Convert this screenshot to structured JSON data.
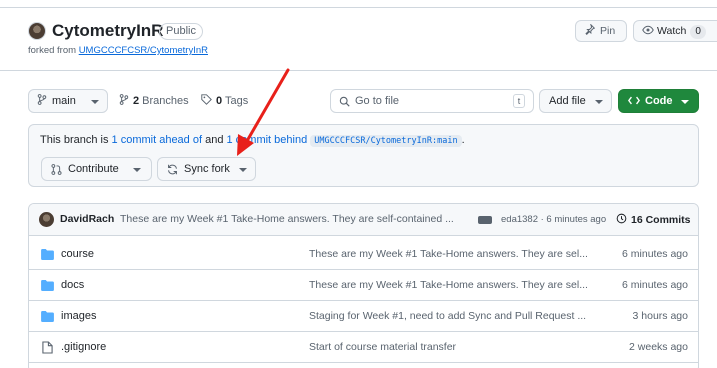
{
  "repo": {
    "name": "CytometryInR",
    "visibility": "Public",
    "forked_prefix": "forked from ",
    "forked_source": "UMGCCCFCSR/CytometryInR",
    "pin_label": "Pin",
    "watch_label": "Watch",
    "watch_count": "0"
  },
  "toolbar": {
    "branch": "main",
    "branches_count": "2",
    "branches_label": " Branches",
    "tags_count": "0",
    "tags_label": " Tags",
    "goto_placeholder": "Go to file",
    "goto_key": "t",
    "add_file_label": "Add file",
    "code_label": "Code"
  },
  "fork_status": {
    "prefix": "This branch is ",
    "ahead": "1 commit ahead of",
    "middle": " and ",
    "behind": "1 commit behind",
    "upstream": "UMGCCCFCSR/CytometryInR:main",
    "suffix": ".",
    "contribute_label": "Contribute",
    "sync_label": "Sync fork"
  },
  "latest_commit": {
    "author": "DavidRach",
    "message": "These are my Week #1 Take-Home answers. They are self-contained ...",
    "sha": "eda1382",
    "time": " · 6 minutes ago",
    "commits_label": "16 Commits"
  },
  "files": [
    {
      "name": "course",
      "type": "folder",
      "message": "These are my Week #1 Take-Home answers. They are sel...",
      "date": "6 minutes ago"
    },
    {
      "name": "docs",
      "type": "folder",
      "message": "These are my Week #1 Take-Home answers. They are sel...",
      "date": "6 minutes ago"
    },
    {
      "name": "images",
      "type": "folder",
      "message": "Staging for Week #1, need to add Sync and Pull Request ...",
      "date": "3 hours ago"
    },
    {
      "name": ".gitignore",
      "type": "file",
      "message": "Start of course material transfer",
      "date": "2 weeks ago"
    }
  ],
  "colors": {
    "accent_link": "#0969da",
    "code_button": "#1f883d",
    "folder_icon": "#54aeff",
    "annotation_arrow": "#e8201a"
  }
}
